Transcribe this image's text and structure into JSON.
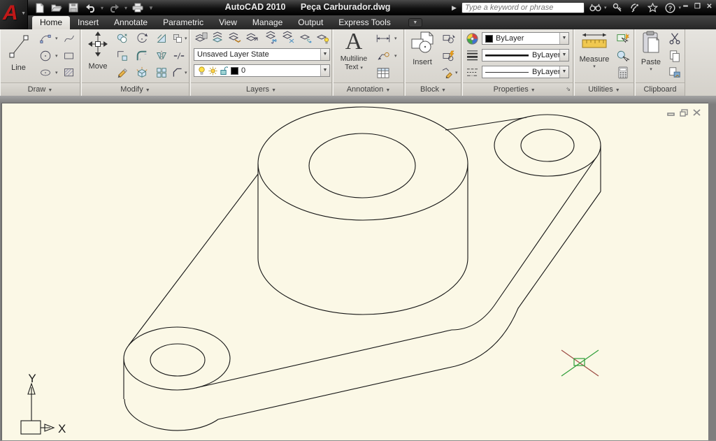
{
  "titlebar": {
    "app_title": "AutoCAD 2010",
    "doc_title": "Peça Carburador.dwg",
    "search_placeholder": "Type a keyword or phrase"
  },
  "tabs": [
    "Home",
    "Insert",
    "Annotate",
    "Parametric",
    "View",
    "Manage",
    "Output",
    "Express Tools"
  ],
  "panels": {
    "draw": {
      "label": "Draw",
      "line": "Line"
    },
    "modify": {
      "label": "Modify",
      "move": "Move"
    },
    "layers": {
      "label": "Layers",
      "layer_state": "Unsaved Layer State",
      "current_layer": "0"
    },
    "annotation": {
      "label": "Annotation",
      "big_a": "A",
      "multiline_1": "Multiline",
      "multiline_2": "Text"
    },
    "block": {
      "label": "Block",
      "insert": "Insert"
    },
    "properties": {
      "label": "Properties",
      "color_value": "ByLayer",
      "lineweight_value": "ByLayer",
      "linetype_value": "ByLayer"
    },
    "utilities": {
      "label": "Utilities",
      "measure": "Measure"
    },
    "clipboard": {
      "label": "Clipboard",
      "paste": "Paste"
    }
  },
  "drawing": {
    "ucs_x": "X",
    "ucs_y": "Y",
    "canvas_color": "#fbf8e6",
    "line_color": "#141414",
    "marker_red": "#9c4a42",
    "marker_green": "#2e9e38"
  }
}
